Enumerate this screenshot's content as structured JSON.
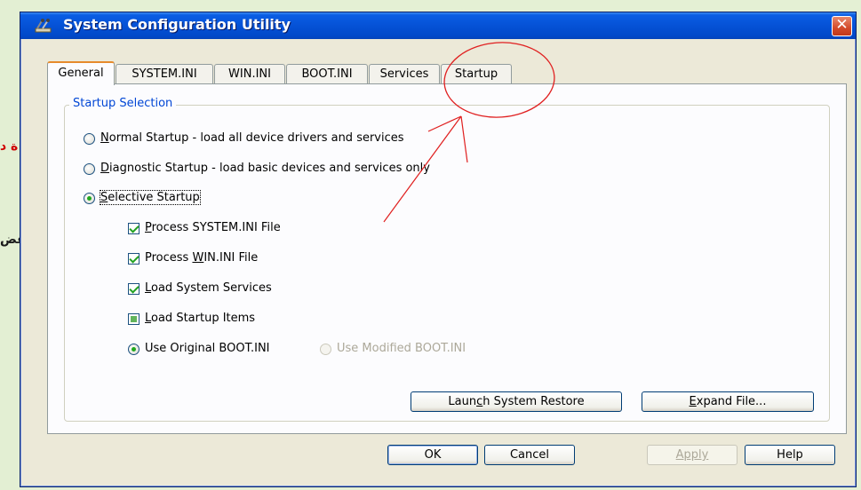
{
  "background": {
    "fragments": [
      "ة د",
      "عض"
    ],
    "color": "#e4f0d4"
  },
  "window": {
    "title": "System Configuration Utility",
    "close_symbol": "✕",
    "icon": "msconfig-icon"
  },
  "tabs": [
    {
      "label": "General",
      "active": true
    },
    {
      "label": "SYSTEM.INI",
      "active": false
    },
    {
      "label": "WIN.INI",
      "active": false
    },
    {
      "label": "BOOT.INI",
      "active": false
    },
    {
      "label": "Services",
      "active": false
    },
    {
      "label": "Startup",
      "active": false
    }
  ],
  "startup_selection": {
    "legend": "Startup Selection",
    "options": [
      {
        "mnemonic": "N",
        "rest": "ormal Startup - load all device drivers and services",
        "selected": false
      },
      {
        "mnemonic": "D",
        "rest": "iagnostic Startup - load basic devices and services only",
        "selected": false
      },
      {
        "mnemonic": "S",
        "rest": "elective Startup",
        "selected": true
      }
    ],
    "checkboxes": [
      {
        "pre": "",
        "mnemonic": "P",
        "rest": "rocess SYSTEM.INI File",
        "state": "checked"
      },
      {
        "pre": "Process ",
        "mnemonic": "W",
        "rest": "IN.INI File",
        "state": "checked"
      },
      {
        "pre": "",
        "mnemonic": "L",
        "rest": "oad System Services",
        "state": "checked"
      },
      {
        "pre": "",
        "mnemonic": "L",
        "rest": "oad Startup Items",
        "state": "indeterminate"
      }
    ],
    "boot_options": [
      {
        "label": "Use Original BOOT.INI",
        "selected": true,
        "enabled": true
      },
      {
        "label": "Use Modified BOOT.INI",
        "selected": false,
        "enabled": false
      }
    ],
    "launch_restore": {
      "pre": "Laun",
      "mnemonic": "c",
      "rest": "h System Restore"
    },
    "expand_file": {
      "pre": "",
      "mnemonic": "E",
      "rest": "xpand File..."
    }
  },
  "footer": {
    "ok": "OK",
    "cancel": "Cancel",
    "apply": "Apply",
    "help": "Help"
  },
  "colors": {
    "annotation": "#e02020",
    "title_bar": "#0552d6",
    "legend_text": "#0046d5",
    "active_tab_accent": "#e68b2c"
  }
}
